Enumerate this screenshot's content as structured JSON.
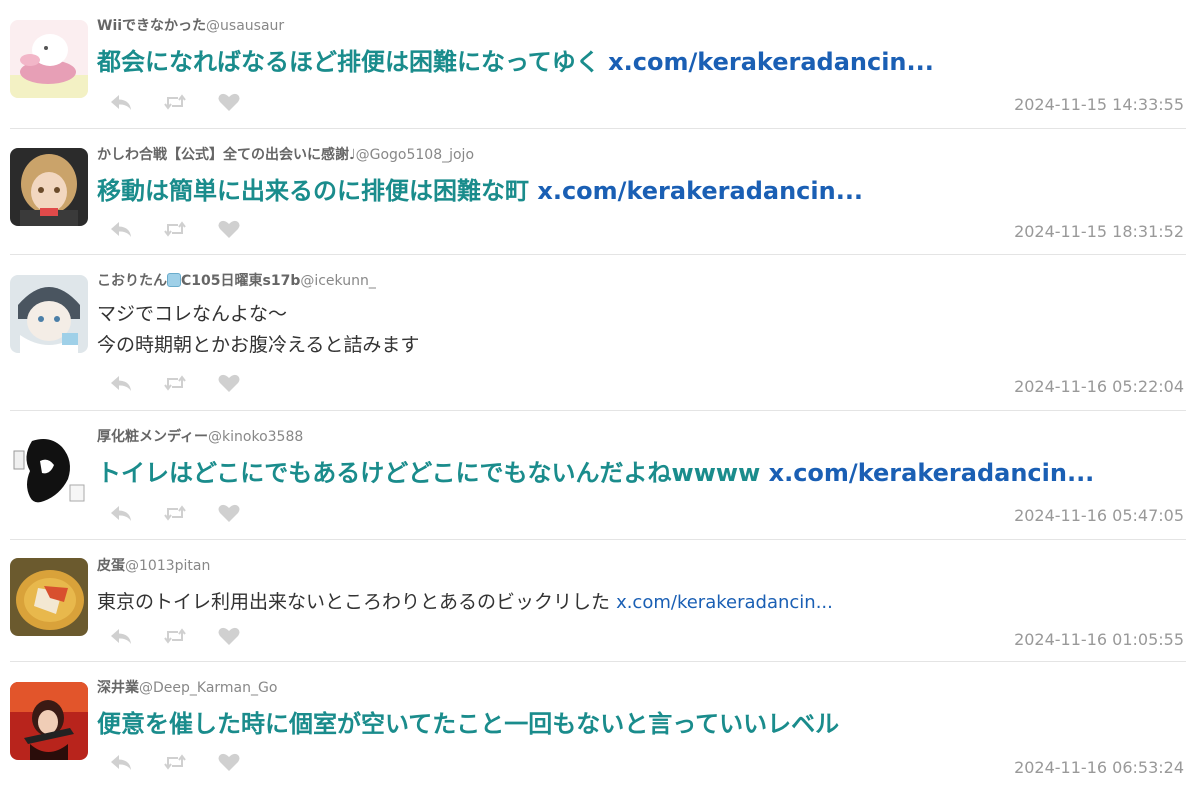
{
  "tweets": [
    {
      "display_name": "Wiiできなかった",
      "screen_name": "@usausaur",
      "text": "都会になればなるほど排便は困難になってゆく",
      "link": "x.com/kerakeradancin...",
      "timestamp": "2024-11-15 14:33:55",
      "style": "big"
    },
    {
      "display_name": "かしわ合戦【公式】全ての出会いに感謝♩",
      "screen_name": "@Gogo5108_jojo",
      "text": "移動は簡単に出来るのに排便は困難な町",
      "link": "x.com/kerakeradancin...",
      "timestamp": "2024-11-15 18:31:52",
      "style": "big"
    },
    {
      "display_name_pre": "こおりたん",
      "display_name_post": "C105日曜東s17b",
      "screen_name": "@icekunn_",
      "text_line1": "マジでコレなんよな〜",
      "text_line2": "今の時期朝とかお腹冷えると詰みます",
      "timestamp": "2024-11-16 05:22:04",
      "style": "normal"
    },
    {
      "display_name": "厚化粧メンディー",
      "screen_name": "@kinoko3588",
      "text": "トイレはどこにでもあるけどどこにでもないんだよねwwww",
      "link": "x.com/kerakeradancin...",
      "timestamp": "2024-11-16 05:47:05",
      "style": "big"
    },
    {
      "display_name": "皮蛋",
      "screen_name": "@1013pitan",
      "text": "東京のトイレ利用出来ないところわりとあるのビックリした",
      "link": "x.com/kerakeradancin...",
      "timestamp": "2024-11-16 01:05:55",
      "style": "normal"
    },
    {
      "display_name": "深井業",
      "screen_name": "@Deep_Karman_Go",
      "text": "便意を催した時に個室が空いてたこと一回もないと言っていいレベル",
      "timestamp": "2024-11-16 06:53:24",
      "style": "big"
    }
  ],
  "action_icons": [
    "reply-icon",
    "retweet-icon",
    "like-icon"
  ],
  "colors": {
    "big_text": "#1a8c8c",
    "link": "#1a5fb4",
    "icon": "#d0d0d0",
    "timestamp": "#999999"
  }
}
